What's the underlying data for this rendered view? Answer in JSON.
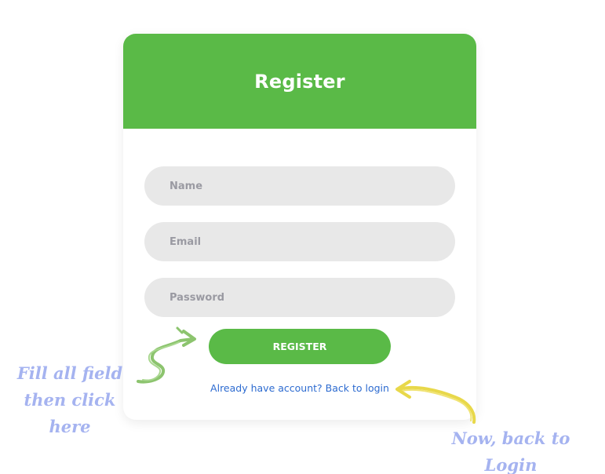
{
  "register_card": {
    "title": "Register",
    "fields": {
      "name_placeholder": "Name",
      "email_placeholder": "Email",
      "password_placeholder": "Password"
    },
    "register_button_label": "REGISTER",
    "back_link_text": "Already have account? Back to login"
  },
  "annotations": {
    "fill_fields_line1": "Fill all field",
    "fill_fields_line2": "then click here",
    "back_to_login": "Now, back to Login"
  },
  "colors": {
    "header_green": "#5aba47",
    "button_green": "#5aba47",
    "input_background": "#e8e8e8",
    "link_blue": "#2d6bd0",
    "annotation_lavender": "#a5b3f0",
    "green_arrow": "#8cc46e",
    "yellow_arrow": "#e8d84a"
  },
  "icons": {
    "register_pointer": "squiggle-arrow-green",
    "login_pointer": "curved-arrow-yellow"
  }
}
